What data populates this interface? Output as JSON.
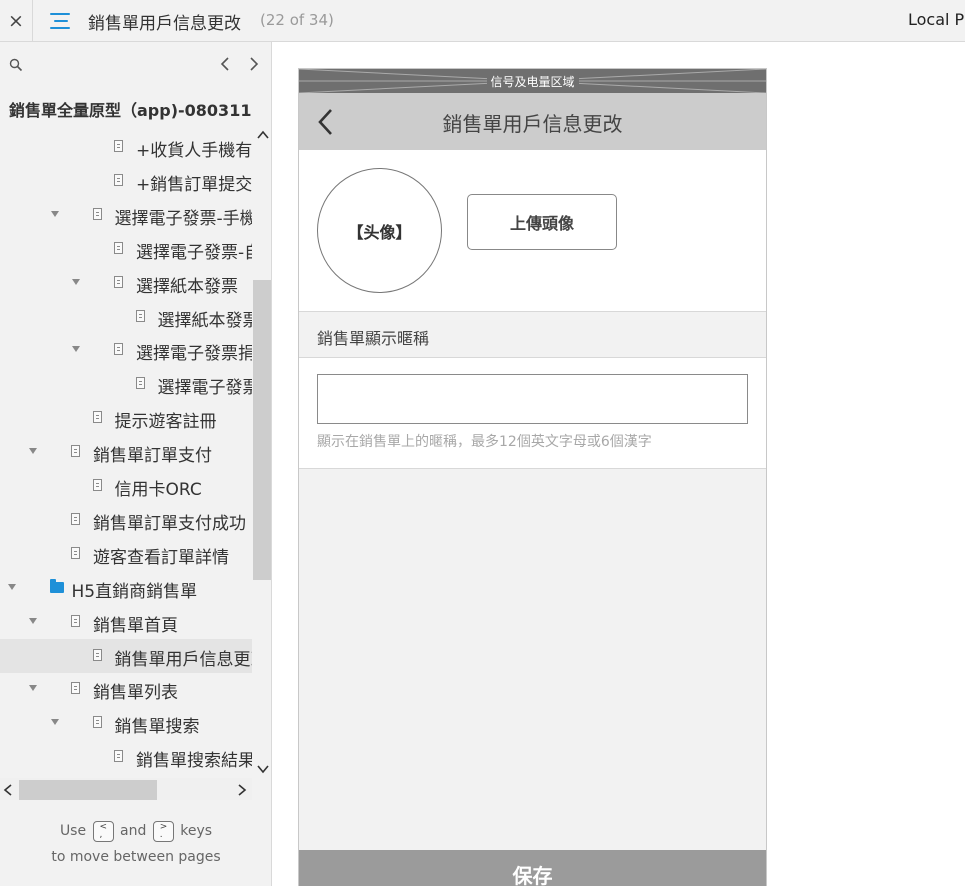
{
  "topbar": {
    "close_label": "×",
    "page_name": "銷售單用戶信息更改",
    "page_count": "(22 of 34)",
    "right_label": "Local Pr"
  },
  "sidebar": {
    "project_title": "銷售單全量原型（app)-080311",
    "tree": [
      {
        "label": "+收貨人手機有歷!",
        "depth": 4,
        "type": "page",
        "expanded": null,
        "selected": false
      },
      {
        "label": "+銷售訂單提交-選",
        "depth": 4,
        "type": "page",
        "expanded": null,
        "selected": false
      },
      {
        "label": "選擇電子發票-手機",
        "depth": 3,
        "type": "page",
        "expanded": true,
        "selected": false
      },
      {
        "label": "選擇電子發票-自然",
        "depth": 4,
        "type": "page",
        "expanded": null,
        "selected": false
      },
      {
        "label": "選擇紙本發票",
        "depth": 4,
        "type": "page",
        "expanded": true,
        "selected": false
      },
      {
        "label": "選擇紙本發票-手",
        "depth": 5,
        "type": "page",
        "expanded": null,
        "selected": false
      },
      {
        "label": "選擇電子發票捐贈",
        "depth": 4,
        "type": "page",
        "expanded": true,
        "selected": false
      },
      {
        "label": "選擇電子發票捐",
        "depth": 5,
        "type": "page",
        "expanded": null,
        "selected": false
      },
      {
        "label": "提示遊客註冊",
        "depth": 3,
        "type": "page",
        "expanded": null,
        "selected": false
      },
      {
        "label": "銷售單訂單支付",
        "depth": 2,
        "type": "page",
        "expanded": true,
        "selected": false
      },
      {
        "label": "信用卡ORC",
        "depth": 3,
        "type": "page",
        "expanded": null,
        "selected": false
      },
      {
        "label": "銷售單訂單支付成功",
        "depth": 2,
        "type": "page",
        "expanded": null,
        "selected": false
      },
      {
        "label": "遊客查看訂單詳情",
        "depth": 2,
        "type": "page",
        "expanded": null,
        "selected": false
      },
      {
        "label": "H5直銷商銷售單",
        "depth": 1,
        "type": "folder",
        "expanded": true,
        "selected": false
      },
      {
        "label": "銷售單首頁",
        "depth": 2,
        "type": "page",
        "expanded": true,
        "selected": false
      },
      {
        "label": "銷售單用戶信息更改",
        "depth": 3,
        "type": "page",
        "expanded": null,
        "selected": true
      },
      {
        "label": "銷售單列表",
        "depth": 2,
        "type": "page",
        "expanded": true,
        "selected": false
      },
      {
        "label": "銷售單搜索",
        "depth": 3,
        "type": "page",
        "expanded": true,
        "selected": false
      },
      {
        "label": "銷售單搜索結果",
        "depth": 4,
        "type": "page",
        "expanded": null,
        "selected": false
      }
    ],
    "hint": {
      "use": "Use",
      "and": "and",
      "keys": "keys",
      "line2": "to move between pages",
      "key_prev_top": "<",
      "key_prev_bottom": ",",
      "key_next_top": ">",
      "key_next_bottom": "."
    }
  },
  "phone": {
    "status_bar_label": "信号及电量区域",
    "header_title": "銷售單用戶信息更改",
    "avatar_label": "【头像】",
    "upload_button": "上傳頭像",
    "nickname_label": "銷售單顯示暱稱",
    "nickname_value": "",
    "nickname_hint": "顯示在銷售單上的暱稱，最多12個英文字母或6個漢字",
    "save_button": "保存"
  },
  "colors": {
    "accent": "#1e90d8",
    "status_bar": "#6f6f6f",
    "header_bg": "#cccccc",
    "save_bg": "#9b9b9b",
    "sidebar_bg": "#f2f2f2"
  },
  "icons": {
    "close": "close-icon",
    "menu": "hamburger-menu-icon",
    "search": "search-icon",
    "prev": "chevron-left-icon",
    "next": "chevron-right-icon",
    "back": "back-arrow-icon",
    "page": "page-icon",
    "folder": "folder-icon"
  }
}
